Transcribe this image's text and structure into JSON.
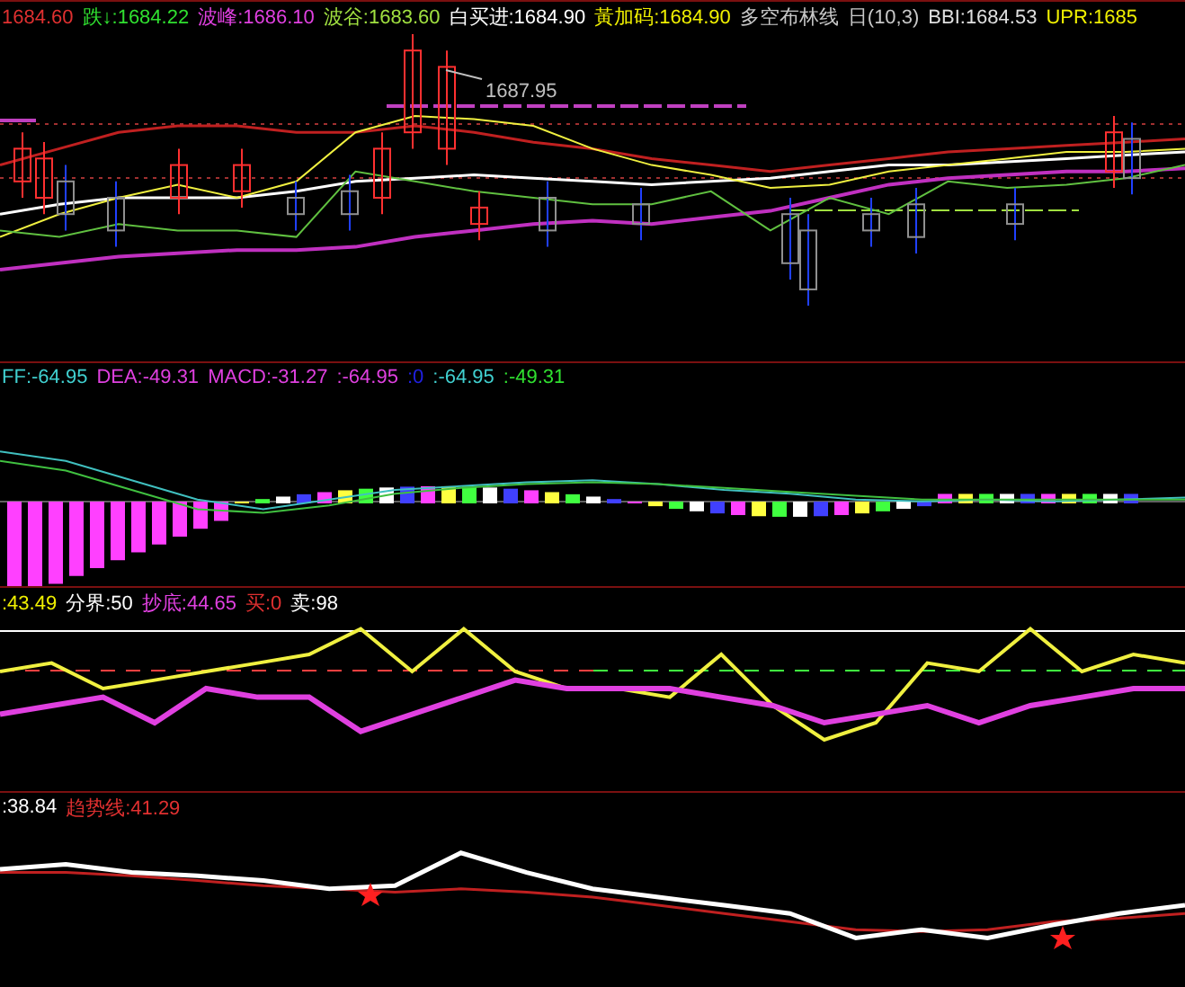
{
  "panels": [
    {
      "kind": "price",
      "legend": [
        {
          "label": "1684.60",
          "color": "#e03030"
        },
        {
          "label": "跌↓:1684.22",
          "color": "#30e030"
        },
        {
          "label": "波峰:1686.10",
          "color": "#e040e0"
        },
        {
          "label": "波谷:1683.60",
          "color": "#a0e040"
        },
        {
          "label": "白买进:1684.90",
          "color": "#ffffff"
        },
        {
          "label": "黃加码:1684.90",
          "color": "#f0f000"
        },
        {
          "label": "多空布林线",
          "color": "#c8c8c8"
        },
        {
          "label": "日(10,3)",
          "color": "#c8c8c8"
        },
        {
          "label": "BBI:1684.53",
          "color": "#e0e0e0"
        },
        {
          "label": "UPR:1685",
          "color": "#f0f000"
        }
      ],
      "annotation": "1687.95"
    },
    {
      "kind": "macd",
      "legend": [
        {
          "label": "FF:-64.95",
          "color": "#40d0d0"
        },
        {
          "label": "DEA:-49.31",
          "color": "#e040e0"
        },
        {
          "label": "MACD:-31.27",
          "color": "#e040e0"
        },
        {
          "label": ":-64.95",
          "color": "#e040e0"
        },
        {
          "label": ":0",
          "color": "#2020e0"
        },
        {
          "label": ":-64.95",
          "color": "#40d0d0"
        },
        {
          "label": ":-49.31",
          "color": "#30e030"
        }
      ]
    },
    {
      "kind": "oscillator",
      "legend": [
        {
          "label": ":43.49",
          "color": "#f0f000"
        },
        {
          "label": "分界:50",
          "color": "#ffffff"
        },
        {
          "label": "抄底:44.65",
          "color": "#e040e0"
        },
        {
          "label": "买:0",
          "color": "#e03030"
        },
        {
          "label": "卖:98",
          "color": "#ffffff"
        }
      ]
    },
    {
      "kind": "trend",
      "legend": [
        {
          "label": ":38.84",
          "color": "#ffffff"
        },
        {
          "label": "趋势线:41.29",
          "color": "#e03030"
        }
      ]
    }
  ]
}
